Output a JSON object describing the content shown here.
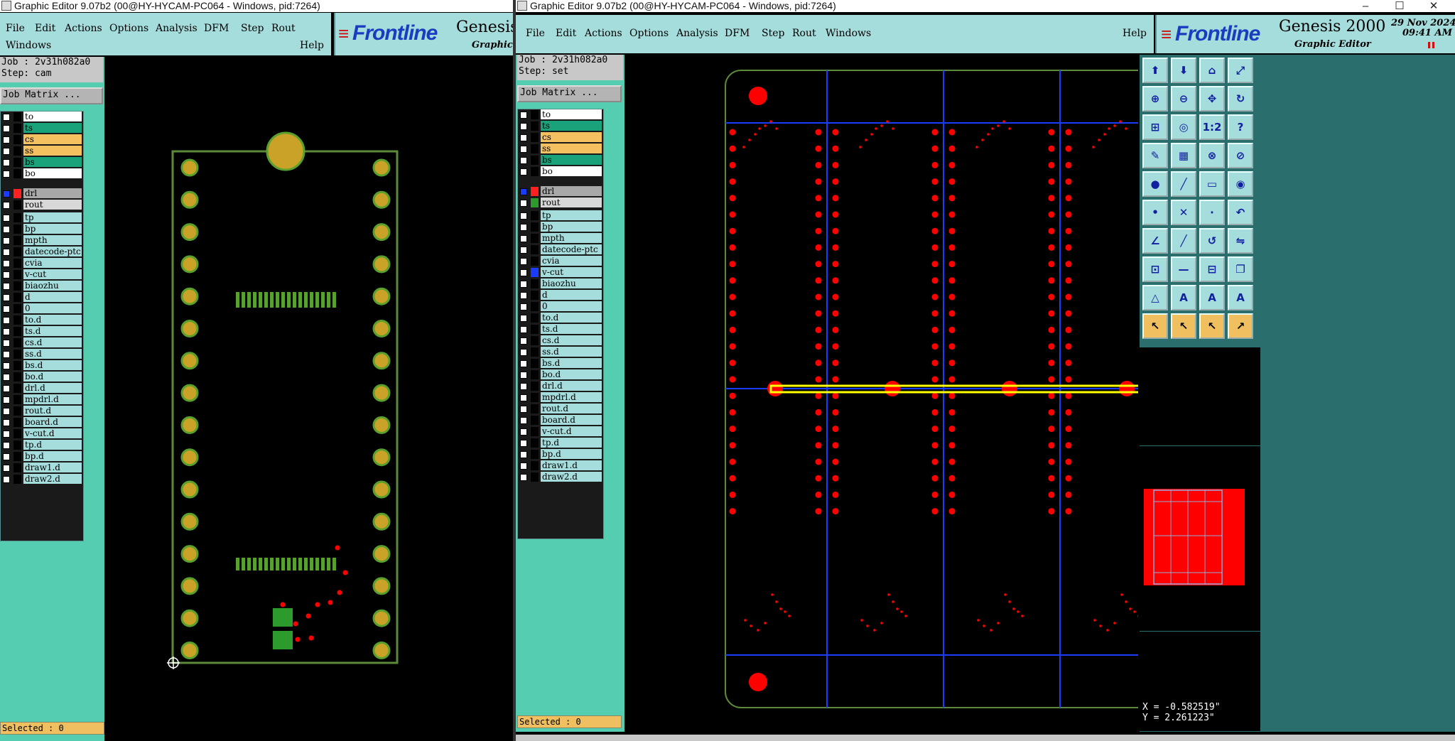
{
  "win_left": {
    "title": "Graphic Editor 9.07b2 (00@HY-HYCAM-PC064 - Windows, pid:7264)",
    "menu": [
      "File",
      "Edit",
      "Actions",
      "Options",
      "Analysis",
      "DFM",
      "Step",
      "Rout"
    ],
    "menu_row2": [
      "Windows",
      "Help"
    ],
    "logo": {
      "brand": "Frontline",
      "product": "Genesis",
      "subtitle": "Graphic E"
    },
    "job_line": "Job : 2v31h082a0",
    "step_line": "Step: cam",
    "job_matrix_button": "Job Matrix ...",
    "selected_text": "Selected : 0"
  },
  "win_right": {
    "title": "Graphic Editor 9.07b2 (00@HY-HYCAM-PC064 - Windows, pid:7264)",
    "window_controls": [
      "–",
      "☐",
      "✕"
    ],
    "menu": [
      "File",
      "Edit",
      "Actions",
      "Options",
      "Analysis",
      "DFM",
      "Step",
      "Rout",
      "Windows"
    ],
    "help": "Help",
    "logo": {
      "brand": "Frontline",
      "product": "Genesis 2000",
      "subtitle": "Graphic Editor",
      "date": "29 Nov 2024",
      "time": "09:41 AM"
    },
    "job_line": "Job : 2v31h082a0",
    "step_line": "Step: set",
    "job_matrix_button": "Job Matrix ...",
    "selected_text": "Selected : 0",
    "coords": {
      "x": "X = -0.582519\"",
      "y": "Y = 2.261223\""
    }
  },
  "layer_groups": [
    [
      {
        "name": "to",
        "color": "#ffffff"
      },
      {
        "name": "ts",
        "color": "#1aa37a"
      },
      {
        "name": "cs",
        "color": "#f4c060"
      },
      {
        "name": "ss",
        "color": "#f4c060"
      },
      {
        "name": "bs",
        "color": "#1aa37a"
      },
      {
        "name": "bo",
        "color": "#ffffff"
      }
    ],
    [
      {
        "name": "drl",
        "color": "#a8a8a8"
      },
      {
        "name": "rout",
        "color": "#d8d8d8"
      }
    ],
    [
      {
        "name": "tp",
        "color": "#a5dcdc"
      },
      {
        "name": "bp",
        "color": "#a5dcdc"
      },
      {
        "name": "mpth",
        "color": "#a5dcdc"
      },
      {
        "name": "datecode-ptc",
        "color": "#a5dcdc"
      },
      {
        "name": "cvia",
        "color": "#a5dcdc"
      },
      {
        "name": "v-cut",
        "color": "#a5dcdc"
      },
      {
        "name": "biaozhu",
        "color": "#a5dcdc"
      },
      {
        "name": "d",
        "color": "#a5dcdc"
      },
      {
        "name": "0",
        "color": "#a5dcdc"
      },
      {
        "name": "to.d",
        "color": "#a5dcdc"
      },
      {
        "name": "ts.d",
        "color": "#a5dcdc"
      },
      {
        "name": "cs.d",
        "color": "#a5dcdc"
      },
      {
        "name": "ss.d",
        "color": "#a5dcdc"
      },
      {
        "name": "bs.d",
        "color": "#a5dcdc"
      },
      {
        "name": "bo.d",
        "color": "#a5dcdc"
      },
      {
        "name": "drl.d",
        "color": "#a5dcdc"
      },
      {
        "name": "mpdrl.d",
        "color": "#a5dcdc"
      },
      {
        "name": "rout.d",
        "color": "#a5dcdc"
      },
      {
        "name": "board.d",
        "color": "#a5dcdc"
      },
      {
        "name": "v-cut.d",
        "color": "#a5dcdc"
      },
      {
        "name": "tp.d",
        "color": "#a5dcdc"
      },
      {
        "name": "bp.d",
        "color": "#a5dcdc"
      },
      {
        "name": "draw1.d",
        "color": "#a5dcdc"
      },
      {
        "name": "draw2.d",
        "color": "#a5dcdc"
      }
    ]
  ],
  "colors": {
    "menu_bg": "#a5dcdc",
    "panel_teal": "#55cdb0",
    "board_outline": "#5d8a3a",
    "pad_gold": "#c9a227",
    "pad_green": "#5aa02c",
    "drill_red": "#ff0000",
    "vcut_blue": "#1a3cff",
    "highlight_yellow": "#ffff00"
  },
  "toolbar_icons": [
    "layer-up-icon",
    "layer-down-icon",
    "home-icon",
    "fit-icon",
    "zoom-in-icon",
    "zoom-out-icon",
    "pan-icon",
    "redraw-icon",
    "zoom-window-icon",
    "zoom-center-icon",
    "scale-1-2-icon",
    "help-icon",
    "measure-icon",
    "grid-icon",
    "snap-icon",
    "snap-alt-icon",
    "pad-icon",
    "line-icon",
    "ruler-icon",
    "circle-icon",
    "node-icon",
    "cross-icon",
    "point-icon",
    "arc-icon",
    "angle-icon",
    "slope-icon",
    "rotate-icon",
    "flip-icon",
    "dimension-icon",
    "minus-icon",
    "align-icon",
    "copy-icon",
    "profile-icon",
    "text-a-icon",
    "text-a-box-icon",
    "text-a-alt-icon",
    "select-icon",
    "select-alt-icon",
    "select-touch-icon",
    "select-path-icon"
  ]
}
